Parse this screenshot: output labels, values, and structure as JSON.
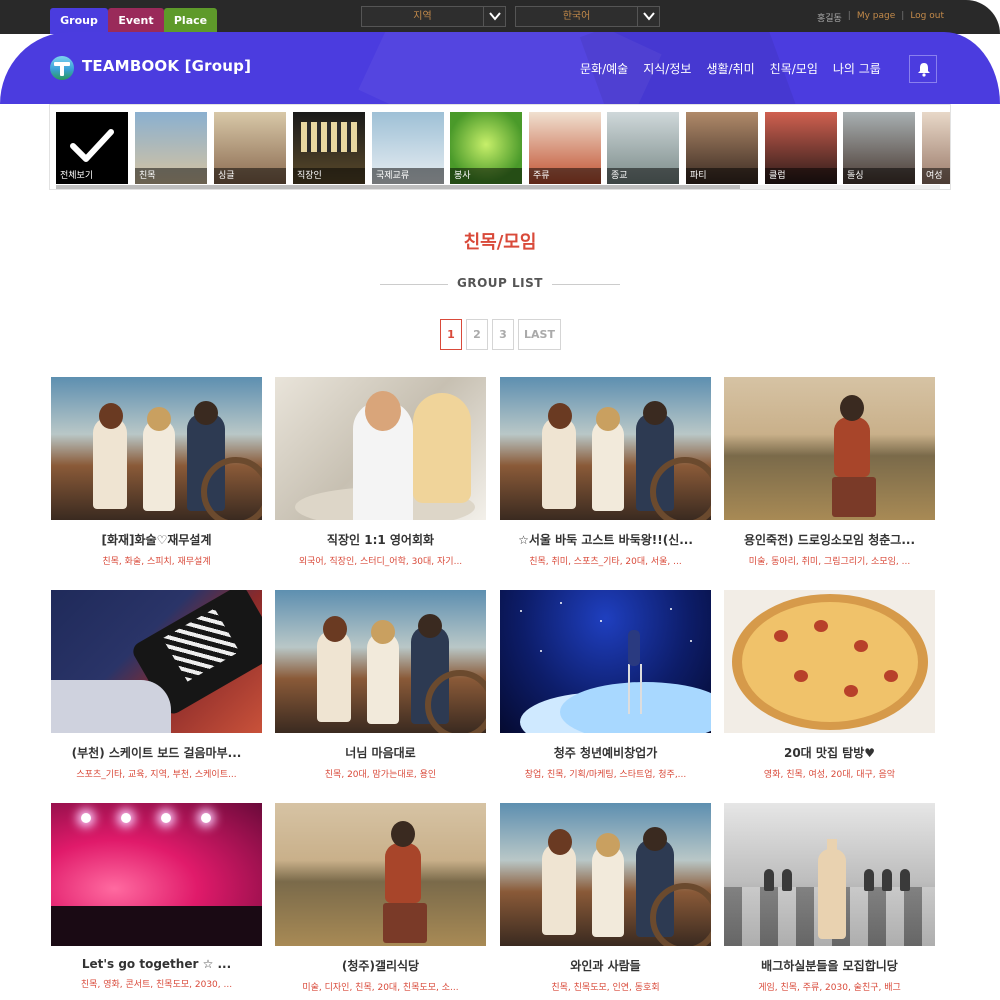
{
  "topbar": {
    "tabs": [
      "Group",
      "Event",
      "Place"
    ],
    "region_select": "지역",
    "language_select": "한국어",
    "user": "홍길동",
    "mypage": "My page",
    "logout": "Log out"
  },
  "header": {
    "brand": "TEAMBOOK [Group]",
    "nav": [
      "문화/예술",
      "지식/정보",
      "생활/취미",
      "친목/모임",
      "나의 그룹"
    ]
  },
  "categories": [
    "전체보기",
    "친목",
    "싱글",
    "직장인",
    "국제교류",
    "봉사",
    "주류",
    "종교",
    "파티",
    "클럽",
    "돌싱",
    "여성"
  ],
  "page": {
    "title": "친목/모임",
    "section": "GROUP LIST",
    "pages": [
      "1",
      "2",
      "3"
    ],
    "last": "LAST",
    "current_page": "1"
  },
  "cards": [
    {
      "title": "[화재]화술♡재무설계",
      "tags": "친목, 화술, 스피치, 재무설계"
    },
    {
      "title": "직장인 1:1 영어회화",
      "tags": "외국어, 직장인, 스터디_어학, 30대, 자기..."
    },
    {
      "title": "☆서울 바둑 고스트 바둑왕!!(신...",
      "tags": "친목, 취미, 스포츠_기타, 20대, 서울, ..."
    },
    {
      "title": "용인죽전) 드로잉소모임 청춘그...",
      "tags": "미술, 동아리, 취미, 그림그리기, 소모임, ..."
    },
    {
      "title": "(부천) 스케이트 보드 걸음마부...",
      "tags": "스포츠_기타, 교육, 지역, 부천, 스케이트..."
    },
    {
      "title": "너님 마음대로",
      "tags": "친목, 20대, 맘가는대로, 용인"
    },
    {
      "title": "청주 청년예비창업가",
      "tags": "창업, 친목, 기획/마케팅, 스타트업, 청주,..."
    },
    {
      "title": "20대 맛집 탐방♥",
      "tags": "영화, 친목, 여성, 20대, 대구, 음악"
    },
    {
      "title": "Let's go together ☆ ...",
      "tags": "친목, 영화, 콘서트, 친목도모, 2030, ..."
    },
    {
      "title": "(청주)갤리식당",
      "tags": "미술, 디자인, 친목, 20대, 친목도모, 소..."
    },
    {
      "title": "와인과 사람들",
      "tags": "친목, 친목도모, 인연, 동호회"
    },
    {
      "title": "배그하실분들을 모집합니당",
      "tags": "게임, 친목, 주류, 2030, 술친구, 배그"
    }
  ]
}
